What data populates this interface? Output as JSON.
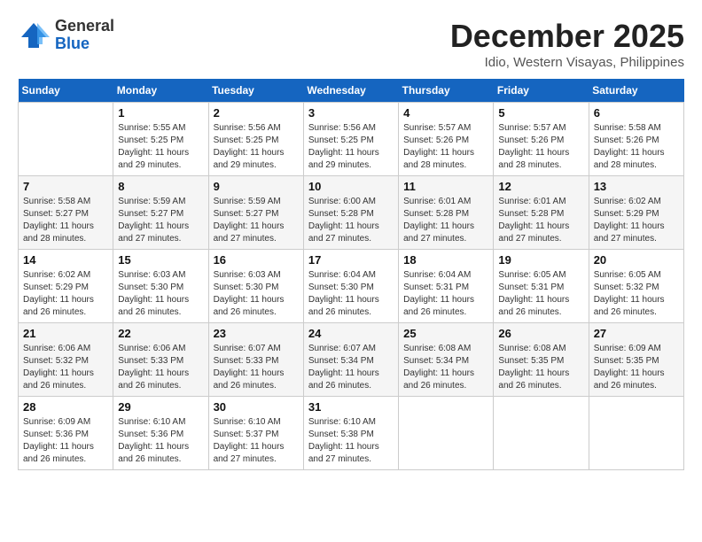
{
  "header": {
    "logo": {
      "line1": "General",
      "line2": "Blue"
    },
    "title": "December 2025",
    "location": "Idio, Western Visayas, Philippines"
  },
  "weekdays": [
    "Sunday",
    "Monday",
    "Tuesday",
    "Wednesday",
    "Thursday",
    "Friday",
    "Saturday"
  ],
  "weeks": [
    [
      {
        "day": "",
        "sunrise": "",
        "sunset": "",
        "daylight": ""
      },
      {
        "day": "1",
        "sunrise": "Sunrise: 5:55 AM",
        "sunset": "Sunset: 5:25 PM",
        "daylight": "Daylight: 11 hours and 29 minutes."
      },
      {
        "day": "2",
        "sunrise": "Sunrise: 5:56 AM",
        "sunset": "Sunset: 5:25 PM",
        "daylight": "Daylight: 11 hours and 29 minutes."
      },
      {
        "day": "3",
        "sunrise": "Sunrise: 5:56 AM",
        "sunset": "Sunset: 5:25 PM",
        "daylight": "Daylight: 11 hours and 29 minutes."
      },
      {
        "day": "4",
        "sunrise": "Sunrise: 5:57 AM",
        "sunset": "Sunset: 5:26 PM",
        "daylight": "Daylight: 11 hours and 28 minutes."
      },
      {
        "day": "5",
        "sunrise": "Sunrise: 5:57 AM",
        "sunset": "Sunset: 5:26 PM",
        "daylight": "Daylight: 11 hours and 28 minutes."
      },
      {
        "day": "6",
        "sunrise": "Sunrise: 5:58 AM",
        "sunset": "Sunset: 5:26 PM",
        "daylight": "Daylight: 11 hours and 28 minutes."
      }
    ],
    [
      {
        "day": "7",
        "sunrise": "Sunrise: 5:58 AM",
        "sunset": "Sunset: 5:27 PM",
        "daylight": "Daylight: 11 hours and 28 minutes."
      },
      {
        "day": "8",
        "sunrise": "Sunrise: 5:59 AM",
        "sunset": "Sunset: 5:27 PM",
        "daylight": "Daylight: 11 hours and 27 minutes."
      },
      {
        "day": "9",
        "sunrise": "Sunrise: 5:59 AM",
        "sunset": "Sunset: 5:27 PM",
        "daylight": "Daylight: 11 hours and 27 minutes."
      },
      {
        "day": "10",
        "sunrise": "Sunrise: 6:00 AM",
        "sunset": "Sunset: 5:28 PM",
        "daylight": "Daylight: 11 hours and 27 minutes."
      },
      {
        "day": "11",
        "sunrise": "Sunrise: 6:01 AM",
        "sunset": "Sunset: 5:28 PM",
        "daylight": "Daylight: 11 hours and 27 minutes."
      },
      {
        "day": "12",
        "sunrise": "Sunrise: 6:01 AM",
        "sunset": "Sunset: 5:28 PM",
        "daylight": "Daylight: 11 hours and 27 minutes."
      },
      {
        "day": "13",
        "sunrise": "Sunrise: 6:02 AM",
        "sunset": "Sunset: 5:29 PM",
        "daylight": "Daylight: 11 hours and 27 minutes."
      }
    ],
    [
      {
        "day": "14",
        "sunrise": "Sunrise: 6:02 AM",
        "sunset": "Sunset: 5:29 PM",
        "daylight": "Daylight: 11 hours and 26 minutes."
      },
      {
        "day": "15",
        "sunrise": "Sunrise: 6:03 AM",
        "sunset": "Sunset: 5:30 PM",
        "daylight": "Daylight: 11 hours and 26 minutes."
      },
      {
        "day": "16",
        "sunrise": "Sunrise: 6:03 AM",
        "sunset": "Sunset: 5:30 PM",
        "daylight": "Daylight: 11 hours and 26 minutes."
      },
      {
        "day": "17",
        "sunrise": "Sunrise: 6:04 AM",
        "sunset": "Sunset: 5:30 PM",
        "daylight": "Daylight: 11 hours and 26 minutes."
      },
      {
        "day": "18",
        "sunrise": "Sunrise: 6:04 AM",
        "sunset": "Sunset: 5:31 PM",
        "daylight": "Daylight: 11 hours and 26 minutes."
      },
      {
        "day": "19",
        "sunrise": "Sunrise: 6:05 AM",
        "sunset": "Sunset: 5:31 PM",
        "daylight": "Daylight: 11 hours and 26 minutes."
      },
      {
        "day": "20",
        "sunrise": "Sunrise: 6:05 AM",
        "sunset": "Sunset: 5:32 PM",
        "daylight": "Daylight: 11 hours and 26 minutes."
      }
    ],
    [
      {
        "day": "21",
        "sunrise": "Sunrise: 6:06 AM",
        "sunset": "Sunset: 5:32 PM",
        "daylight": "Daylight: 11 hours and 26 minutes."
      },
      {
        "day": "22",
        "sunrise": "Sunrise: 6:06 AM",
        "sunset": "Sunset: 5:33 PM",
        "daylight": "Daylight: 11 hours and 26 minutes."
      },
      {
        "day": "23",
        "sunrise": "Sunrise: 6:07 AM",
        "sunset": "Sunset: 5:33 PM",
        "daylight": "Daylight: 11 hours and 26 minutes."
      },
      {
        "day": "24",
        "sunrise": "Sunrise: 6:07 AM",
        "sunset": "Sunset: 5:34 PM",
        "daylight": "Daylight: 11 hours and 26 minutes."
      },
      {
        "day": "25",
        "sunrise": "Sunrise: 6:08 AM",
        "sunset": "Sunset: 5:34 PM",
        "daylight": "Daylight: 11 hours and 26 minutes."
      },
      {
        "day": "26",
        "sunrise": "Sunrise: 6:08 AM",
        "sunset": "Sunset: 5:35 PM",
        "daylight": "Daylight: 11 hours and 26 minutes."
      },
      {
        "day": "27",
        "sunrise": "Sunrise: 6:09 AM",
        "sunset": "Sunset: 5:35 PM",
        "daylight": "Daylight: 11 hours and 26 minutes."
      }
    ],
    [
      {
        "day": "28",
        "sunrise": "Sunrise: 6:09 AM",
        "sunset": "Sunset: 5:36 PM",
        "daylight": "Daylight: 11 hours and 26 minutes."
      },
      {
        "day": "29",
        "sunrise": "Sunrise: 6:10 AM",
        "sunset": "Sunset: 5:36 PM",
        "daylight": "Daylight: 11 hours and 26 minutes."
      },
      {
        "day": "30",
        "sunrise": "Sunrise: 6:10 AM",
        "sunset": "Sunset: 5:37 PM",
        "daylight": "Daylight: 11 hours and 27 minutes."
      },
      {
        "day": "31",
        "sunrise": "Sunrise: 6:10 AM",
        "sunset": "Sunset: 5:38 PM",
        "daylight": "Daylight: 11 hours and 27 minutes."
      },
      {
        "day": "",
        "sunrise": "",
        "sunset": "",
        "daylight": ""
      },
      {
        "day": "",
        "sunrise": "",
        "sunset": "",
        "daylight": ""
      },
      {
        "day": "",
        "sunrise": "",
        "sunset": "",
        "daylight": ""
      }
    ]
  ]
}
